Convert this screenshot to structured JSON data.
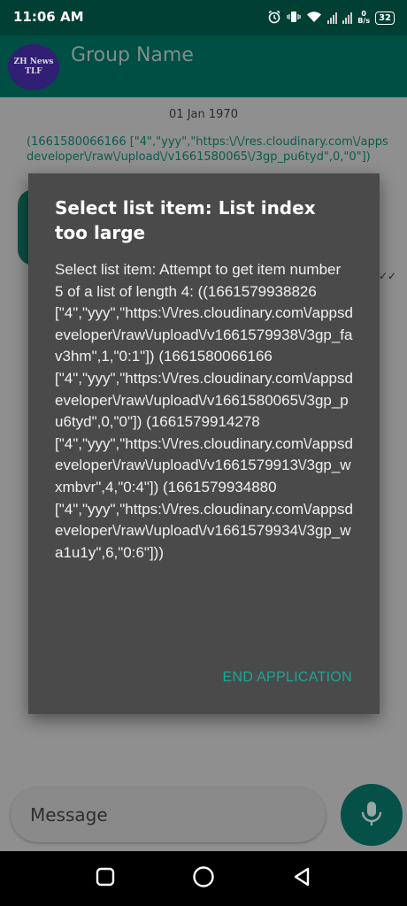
{
  "status_bar": {
    "time": "11:06 AM",
    "net_speed_value": "0",
    "net_speed_unit": "B/s",
    "battery": "32"
  },
  "app_bar": {
    "avatar_line1": "ZH News",
    "avatar_line2": "TLF",
    "group_name": "Group Name"
  },
  "chat": {
    "date": "01 Jan 1970",
    "raw_message": "(1661580066166 [\"4\",\"yyy\",\"https:\\/\\/res.cloudinary.com\\/appsdeveloper\\/raw\\/upload\\/v1661580065\\/3gp_pu6tyd\",0,\"0\"])",
    "read_ticks": "✓✓"
  },
  "input": {
    "placeholder": "Message"
  },
  "dialog": {
    "title": "Select list item: List index too large",
    "message": "Select list item: Attempt to get item number 5 of a list of length 4: ((1661579938826 [\"4\",\"yyy\",\"https:\\/\\/res.cloudinary.com\\/appsdeveloper\\/raw\\/upload\\/v1661579938\\/3gp_fav3hm\",1,\"0:1\"]) (1661580066166 [\"4\",\"yyy\",\"https:\\/\\/res.cloudinary.com\\/appsdeveloper\\/raw\\/upload\\/v1661580065\\/3gp_pu6tyd\",0,\"0\"]) (1661579914278 [\"4\",\"yyy\",\"https:\\/\\/res.cloudinary.com\\/appsdeveloper\\/raw\\/upload\\/v1661579913\\/3gp_wxmbvr\",4,\"0:4\"]) (1661579934880 [\"4\",\"yyy\",\"https:\\/\\/res.cloudinary.com\\/appsdeveloper\\/raw\\/upload\\/v1661579934\\/3gp_wa1u1y\",6,\"0:6\"]))",
    "action_label": "END APPLICATION"
  },
  "icons": {
    "alarm": "alarm-icon",
    "vibrate": "vibrate-icon",
    "wifi": "wifi-icon",
    "signal": "signal-icon",
    "mic": "mic-icon",
    "nav_recents": "recents-icon",
    "nav_home": "home-icon",
    "nav_back": "back-icon"
  },
  "colors": {
    "accent": "#1ea696",
    "app_bar": "#004f44",
    "dialog_bg": "#4a4a4a"
  }
}
